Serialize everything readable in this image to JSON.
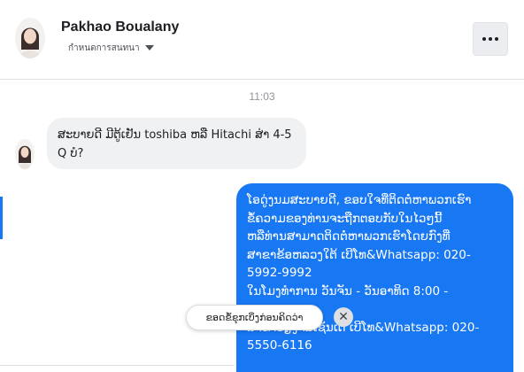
{
  "header": {
    "contact_name": "Pakhao Boualany",
    "status": "กำหนดการสนทนา",
    "avatar_icon": "profile-photo",
    "more_icon": "ellipsis-icon"
  },
  "conversation": {
    "timestamp": "11:03",
    "incoming_message": "ສະບາຍດີ ມີຕູ້ເຢັນ toshiba ຫລື Hitachi ສ່າ 4-5 Q ບໍ?",
    "outgoing_message": "ໂອດູ່ງນມສະບາຍດີ, ຂອບໃຈທີ່ຕິດຕໍ່ຫາພວກເຮົາ\nຂໍ້ຄວາມຂອງທ່ານຈະຖືກຕອບກັບໃນໄວໆນີ້\nຫລືທ່ານສາມາດຕິດຕໍ່ຫາພວກເຮົາໂດຍກົງທີ່\nສາຂາຂ້ອຫລວງໃຕ້ ເບີໂທ&Whatsapp: 020-\n5992-9992\nໃນໂມງທຳການ ວັນຈັນ - ວັນອາທິດ  8:00 -\n\nສາຂາວຽງຈັນເຊັນເຕີ້ ເບີໂທ&Whatsapp: 020-\n5550-6116"
  },
  "overlay": {
    "chip_label": "ຂອດຂໍ້ຂຸກເບິ່ງກ່ອນຄິດວ່າ",
    "close_symbol": "✕"
  },
  "colors": {
    "accent": "#1877f2",
    "incoming_bubble": "#f0f1f3"
  }
}
